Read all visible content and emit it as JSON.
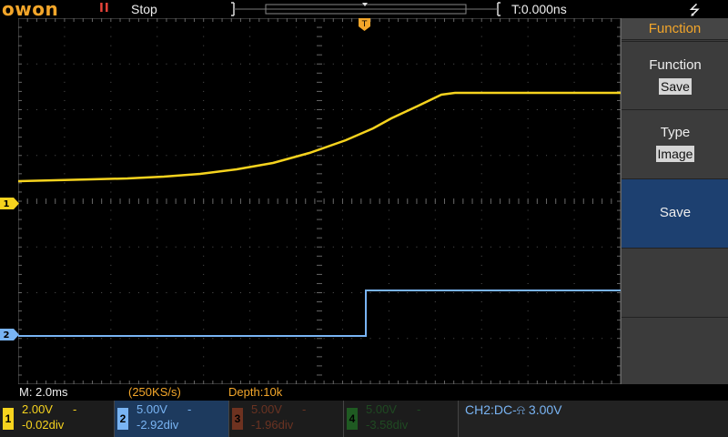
{
  "header": {
    "brand": "OWON",
    "run_state_icon": "II",
    "run_state": "Stop",
    "trigger_time": "T:0.000ns",
    "usb_icon": "usb-icon"
  },
  "menu": {
    "title": "Function",
    "items": [
      {
        "label": "Function",
        "value": "Save"
      },
      {
        "label": "Type",
        "value": "Image"
      },
      {
        "label": "Save"
      }
    ]
  },
  "status": {
    "timebase": "M: 2.0ms",
    "sample_rate": "(250KS/s)",
    "depth": "Depth:10k"
  },
  "channels": [
    {
      "num": "1",
      "volts": "2.00V",
      "coupling": "-",
      "offset": "-0.02div"
    },
    {
      "num": "2",
      "volts": "5.00V",
      "coupling": "-",
      "offset": "-2.92div"
    },
    {
      "num": "3",
      "volts": "5.00V",
      "coupling": "-",
      "offset": "-1.96div"
    },
    {
      "num": "4",
      "volts": "5.00V",
      "coupling": "-",
      "offset": "-3.58div"
    }
  ],
  "trigger": {
    "info": "CH2:DC-⍾ 3.00V",
    "marker": "T"
  },
  "markers": {
    "ch1": "1",
    "ch2": "2"
  },
  "colors": {
    "ch1": "#f6d31e",
    "ch2": "#79b4f3",
    "accent": "#f3a62a",
    "selected": "#1d4070"
  }
}
